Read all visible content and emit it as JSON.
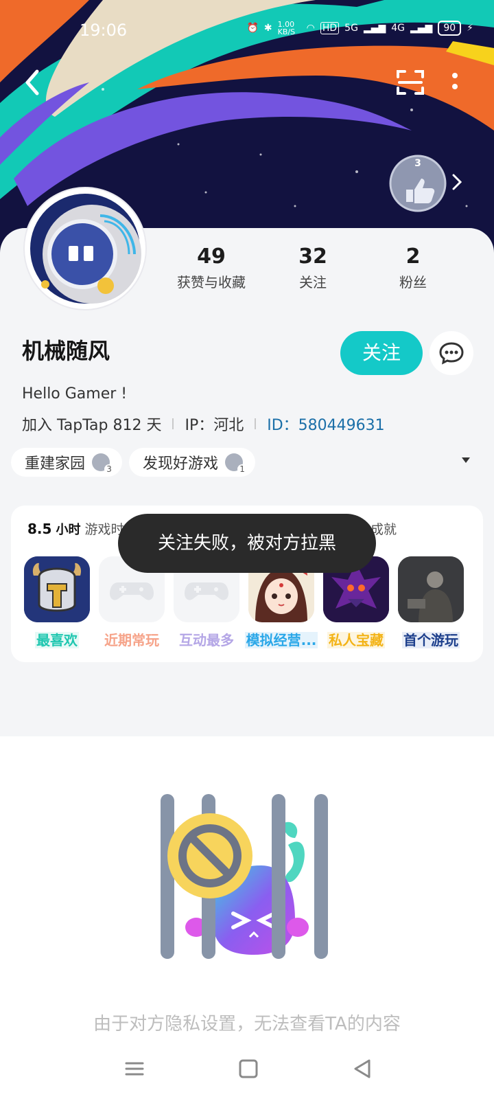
{
  "status_bar": {
    "time": "19:06",
    "net_speed": "1.00 KB/S",
    "hd_label": "HD",
    "net_5g": "5G",
    "net_4g": "4G",
    "battery": "90"
  },
  "header": {
    "back_icon": "chevron-left-icon",
    "scan_icon": "scan-icon",
    "more_icon": "more-vertical-icon",
    "badge_level": "3"
  },
  "profile": {
    "stats": [
      {
        "value": "49",
        "label": "获赞与收藏"
      },
      {
        "value": "32",
        "label": "关注"
      },
      {
        "value": "2",
        "label": "粉丝"
      }
    ],
    "name": "机械随风",
    "follow_label": "关注",
    "bio": "Hello Gamer !",
    "join_text": "加入 TapTap 812 天",
    "ip_text": "IP：河北",
    "id_text": "ID：580449631",
    "tags": [
      {
        "label": "重建家园",
        "badge": "3"
      },
      {
        "label": "发现好游戏",
        "badge": "1"
      }
    ]
  },
  "games": {
    "playtime_value": "8.5",
    "playtime_unit": "小时",
    "playtime_suffix": "游戏时",
    "achievement_suffix": "成就",
    "items": [
      {
        "label": "最喜欢",
        "color": "#1fc7b0"
      },
      {
        "label": "近期常玩",
        "color": "#f6a389"
      },
      {
        "label": "互动最多",
        "color": "#b4a6e6"
      },
      {
        "label": "模拟经营...",
        "color": "#2aa7e8"
      },
      {
        "label": "私人宝藏",
        "color": "#f3b316"
      },
      {
        "label": "首个游玩",
        "color": "#1d3f8c"
      }
    ]
  },
  "toast": {
    "text": "关注失败，被对方拉黑"
  },
  "privacy_notice": "由于对方隐私设置，无法查看TA的内容",
  "colors": {
    "accent": "#14c9c8",
    "banner_bg": "#121240"
  }
}
